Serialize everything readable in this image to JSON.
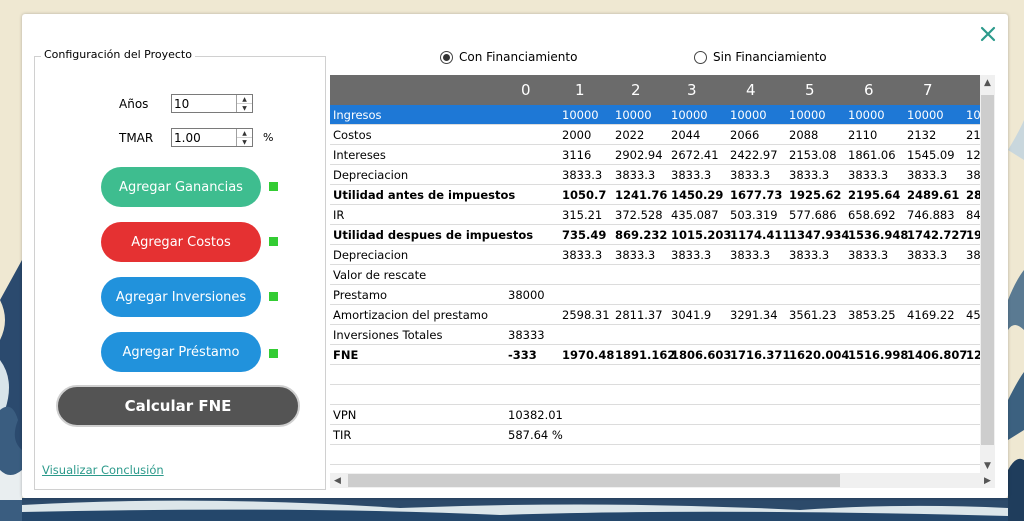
{
  "colors": {
    "green": "#3ebd8f",
    "red": "#e53132",
    "blue": "#2192dc",
    "dark": "#545454",
    "selection": "#1e78d6",
    "header": "#6b6b6b",
    "accent": "#2c9a8b"
  },
  "group_title": "Configuración del Proyecto",
  "anios": {
    "label": "Años",
    "value": "10"
  },
  "tmar": {
    "label": "TMAR",
    "value": "1.00",
    "unit": "%"
  },
  "buttons": {
    "ganancias": "Agregar Ganancias",
    "costos": "Agregar Costos",
    "inversiones": "Agregar Inversiones",
    "prestamo": "Agregar Préstamo",
    "calcular": "Calcular FNE"
  },
  "link": "Visualizar Conclusión",
  "radios": {
    "con": "Con Financiamiento",
    "sin": "Sin Financiamiento",
    "selected": "con"
  },
  "table": {
    "headers": [
      "0",
      "1",
      "2",
      "3",
      "4",
      "5",
      "6",
      "7"
    ],
    "rows": [
      {
        "label": "Ingresos",
        "values": [
          "",
          "10000",
          "10000",
          "10000",
          "10000",
          "10000",
          "10000",
          "10000",
          "10"
        ],
        "bold": false,
        "selected": true
      },
      {
        "label": "Costos",
        "values": [
          "",
          "2000",
          "2022",
          "2044",
          "2066",
          "2088",
          "2110",
          "2132",
          "21"
        ]
      },
      {
        "label": "Intereses",
        "values": [
          "",
          "3116",
          "2902.94",
          "2672.41",
          "2422.97",
          "2153.08",
          "1861.06",
          "1545.09",
          "12"
        ]
      },
      {
        "label": "Depreciacion",
        "values": [
          "",
          "3833.3",
          "3833.3",
          "3833.3",
          "3833.3",
          "3833.3",
          "3833.3",
          "3833.3",
          "38"
        ]
      },
      {
        "label": "Utilidad antes de impuestos",
        "values": [
          "",
          "1050.7",
          "1241.76",
          "1450.29",
          "1677.73",
          "1925.62",
          "2195.64",
          "2489.61",
          "28"
        ],
        "bold": true
      },
      {
        "label": "IR",
        "values": [
          "",
          "315.21",
          "372.528",
          "435.087",
          "503.319",
          "577.686",
          "658.692",
          "746.883",
          "84"
        ]
      },
      {
        "label": "Utilidad despues de impuestos",
        "values": [
          "",
          "735.49",
          "869.232",
          "1015.203",
          "1174.411",
          "1347.934",
          "1536.948",
          "1742.727",
          "19"
        ],
        "bold": true
      },
      {
        "label": "Depreciacion",
        "values": [
          "",
          "3833.3",
          "3833.3",
          "3833.3",
          "3833.3",
          "3833.3",
          "3833.3",
          "3833.3",
          "38"
        ]
      },
      {
        "label": "Valor de rescate",
        "values": [
          "",
          "",
          "",
          "",
          "",
          "",
          "",
          "",
          ""
        ]
      },
      {
        "label": "Prestamo",
        "values": [
          "38000",
          "",
          "",
          "",
          "",
          "",
          "",
          "",
          ""
        ]
      },
      {
        "label": "Amortizacion del prestamo",
        "values": [
          "",
          "2598.31",
          "2811.37",
          "3041.9",
          "3291.34",
          "3561.23",
          "3853.25",
          "4169.22",
          "45"
        ]
      },
      {
        "label": "Inversiones Totales",
        "values": [
          "38333",
          "",
          "",
          "",
          "",
          "",
          "",
          "",
          ""
        ]
      },
      {
        "label": "FNE",
        "values": [
          "-333",
          "1970.48",
          "1891.162",
          "1806.603",
          "1716.371",
          "1620.004",
          "1516.998",
          "1406.807",
          "12"
        ],
        "bold": true
      },
      {
        "label": "",
        "values": [
          "",
          "",
          "",
          "",
          "",
          "",
          "",
          "",
          ""
        ]
      },
      {
        "label": "",
        "values": [
          "",
          "",
          "",
          "",
          "",
          "",
          "",
          "",
          ""
        ]
      },
      {
        "label": "VPN",
        "values": [
          "10382.01",
          "",
          "",
          "",
          "",
          "",
          "",
          "",
          ""
        ]
      },
      {
        "label": "TIR",
        "values": [
          "587.64 %",
          "",
          "",
          "",
          "",
          "",
          "",
          "",
          ""
        ]
      },
      {
        "label": "",
        "values": [
          "",
          "",
          "",
          "",
          "",
          "",
          "",
          "",
          ""
        ]
      }
    ]
  }
}
